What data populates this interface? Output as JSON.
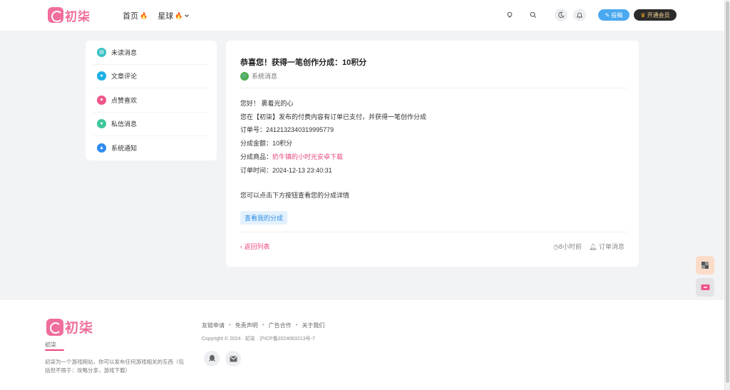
{
  "header": {
    "logo_text": "初柒",
    "nav": [
      {
        "label": "首页",
        "emoji": "🔥"
      },
      {
        "label": "星球",
        "emoji": "🔥"
      }
    ],
    "post_label": "投稿",
    "vip_label": "开通会员"
  },
  "sidebar": {
    "items": [
      {
        "label": "未读消息",
        "color": "#3ac0c4"
      },
      {
        "label": "文章评论",
        "color": "#1eb1e6"
      },
      {
        "label": "点赞喜欢",
        "color": "#f0558a"
      },
      {
        "label": "私信消息",
        "color": "#3ec69b"
      },
      {
        "label": "系统通知",
        "color": "#2f8cf0"
      }
    ]
  },
  "message": {
    "title": "恭喜您！获得一笔创作分成：10积分",
    "category": "系统消息",
    "greeting": "您好！ 裹着光的心",
    "line1": "您在【初柒】发布的付费内容有订单已支付，并获得一笔创作分成",
    "order_no_label": "订单号：",
    "order_no": "2412132340319995779",
    "amount_label": "分成金额：",
    "amount": "10积分",
    "product_label": "分成商品：",
    "product": "奶牛镇的小时光安卓下载",
    "time_label": "订单时间：",
    "time": "2024-12-13 23:40:31",
    "tip": "您可以点击下方按钮查看您的分成详情",
    "button": "查看我的分成",
    "back": "‹ 返回列表",
    "ago": "8小时前",
    "type": "订单消息"
  },
  "footer": {
    "logo_text": "初柒",
    "site_name": "初柒",
    "desc": "初柒为一个游戏网站，你可以发布任何游戏相关的东西（包括但不限于：攻略分享，游戏下载）",
    "links": [
      "友链申请",
      "免责声明",
      "广告合作",
      "关于我们"
    ],
    "copyright": "Copyright © 2024 · 初柒 · 沪ICP备2024063213号-7"
  }
}
